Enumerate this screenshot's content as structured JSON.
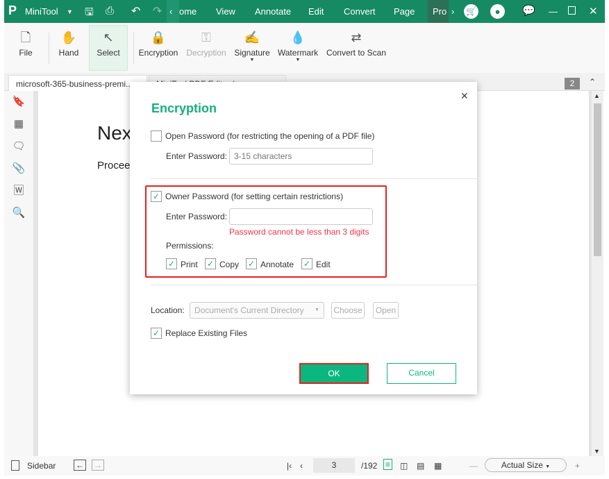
{
  "app": {
    "name": "MiniTool",
    "accent": "#168a63"
  },
  "titlebar": {
    "menus": [
      "ome",
      "View",
      "Annotate",
      "Edit",
      "Convert",
      "Page",
      "Pro"
    ]
  },
  "toolbar": {
    "items": [
      {
        "label": "File",
        "icon": "file-icon"
      },
      {
        "label": "Hand",
        "icon": "hand-icon"
      },
      {
        "label": "Select",
        "icon": "cursor-icon"
      },
      {
        "label": "Encryption",
        "icon": "lock-shield-icon"
      },
      {
        "label": "Decryption",
        "icon": "key-shield-icon"
      },
      {
        "label": "Signature",
        "icon": "signature-icon"
      },
      {
        "label": "Watermark",
        "icon": "watermark-icon"
      },
      {
        "label": "Convert to Scan",
        "icon": "scan-icon"
      }
    ]
  },
  "tabs": [
    {
      "label": "microsoft-365-business-premi..."
    },
    {
      "label": "MiniTool PDF Editor *"
    }
  ],
  "page_count_badge": "2",
  "document": {
    "heading": "Nex",
    "text": "Procee"
  },
  "dialog": {
    "title": "Encryption",
    "open_password": {
      "label": "Open Password (for restricting the opening of a PDF file)",
      "checked": false,
      "field_label": "Enter Password:",
      "placeholder": "3-15 characters"
    },
    "owner_password": {
      "label": "Owner Password (for setting certain restrictions)",
      "checked": true,
      "field_label": "Enter Password:",
      "value": "",
      "error": "Password cannot be less than 3 digits",
      "permissions_label": "Permissions:",
      "permissions": [
        {
          "label": "Print",
          "checked": true
        },
        {
          "label": "Copy",
          "checked": true
        },
        {
          "label": "Annotate",
          "checked": true
        },
        {
          "label": "Edit",
          "checked": true
        }
      ]
    },
    "location_label": "Location:",
    "location_value": "Document's Current Directory",
    "choose": "Choose",
    "open": "Open",
    "replace": {
      "label": "Replace Existing Files",
      "checked": true
    },
    "ok": "OK",
    "cancel": "Cancel"
  },
  "status": {
    "sidebar": "Sidebar",
    "page": "3",
    "total": "/192",
    "zoom": "Actual Size"
  }
}
